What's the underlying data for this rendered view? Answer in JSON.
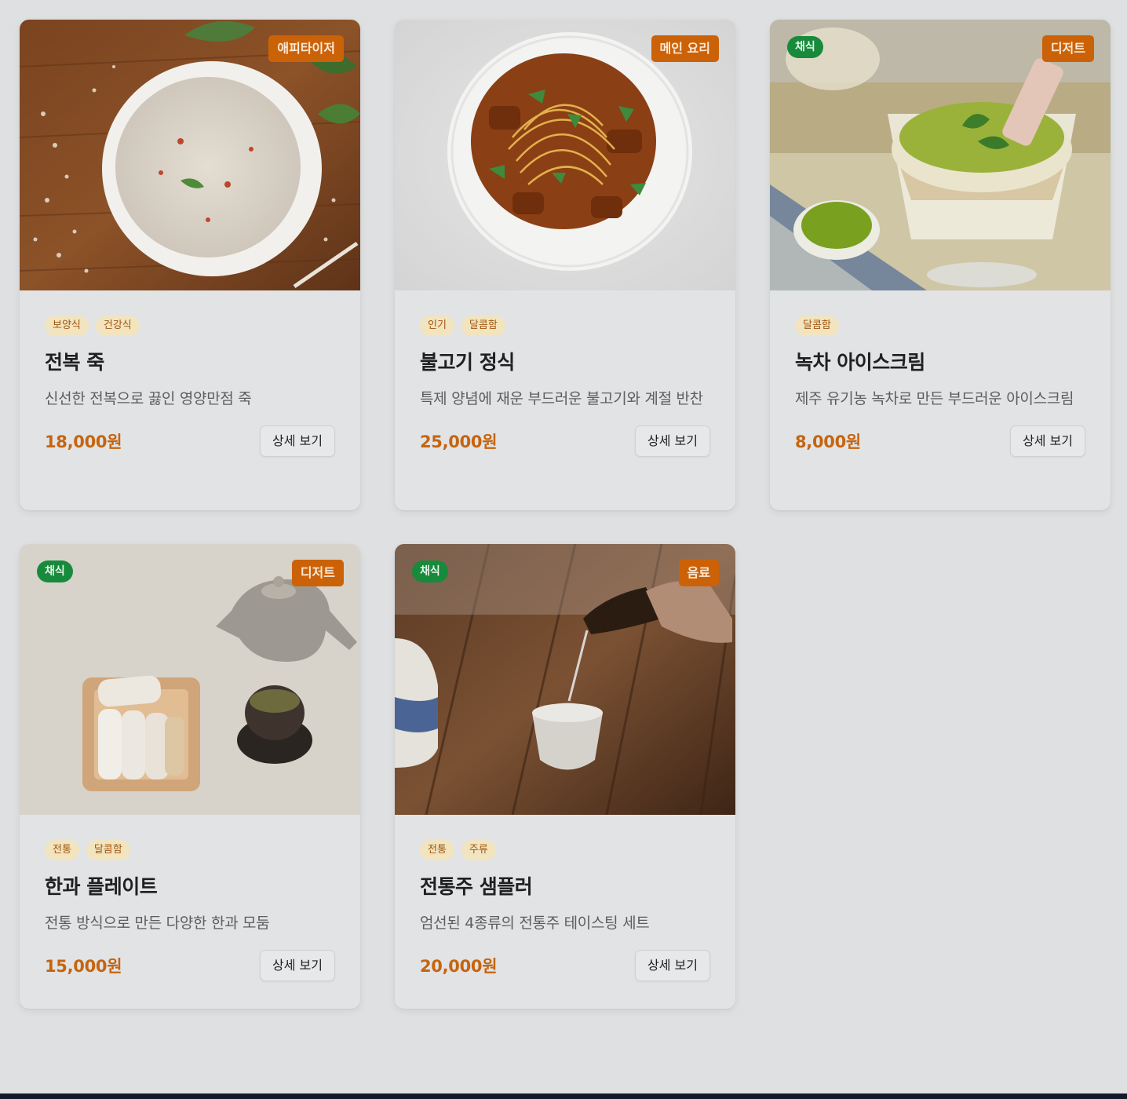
{
  "button_label": "상세 보기",
  "menu_items": [
    {
      "name": "전복 죽",
      "description": "신선한 전복으로 끓인 영양만점 죽",
      "price": "18,000원",
      "category": "애피타이저",
      "vegetarian": null,
      "tags": [
        "보양식",
        "건강식"
      ]
    },
    {
      "name": "불고기 정식",
      "description": "특제 양념에 재운 부드러운 불고기와 계절 반찬",
      "price": "25,000원",
      "category": "메인 요리",
      "vegetarian": null,
      "tags": [
        "인기",
        "달콤함"
      ]
    },
    {
      "name": "녹차 아이스크림",
      "description": "제주 유기농 녹차로 만든 부드러운 아이스크림",
      "price": "8,000원",
      "category": "디저트",
      "vegetarian": "채식",
      "tags": [
        "달콤함"
      ]
    },
    {
      "name": "한과 플레이트",
      "description": "전통 방식으로 만든 다양한 한과 모둠",
      "price": "15,000원",
      "category": "디저트",
      "vegetarian": "채식",
      "tags": [
        "전통",
        "달콤함"
      ]
    },
    {
      "name": "전통주 샘플러",
      "description": "엄선된 4종류의 전통주 테이스팅 세트",
      "price": "20,000원",
      "category": "음료",
      "vegetarian": "채식",
      "tags": [
        "전통",
        "주류"
      ]
    }
  ]
}
